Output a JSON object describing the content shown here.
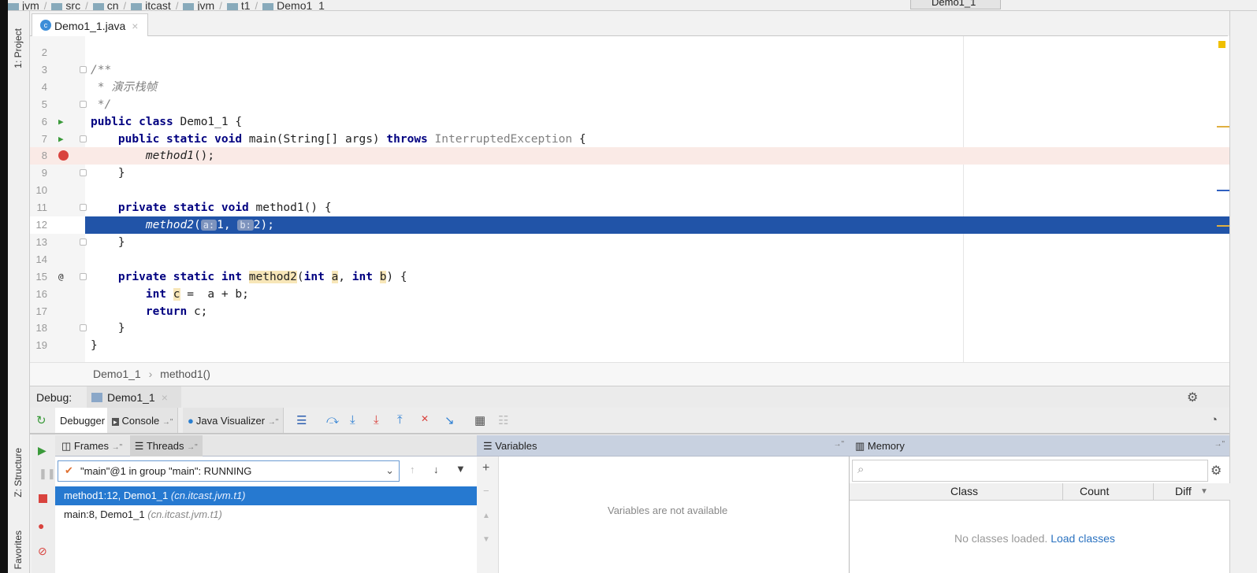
{
  "navbar": {
    "crumbs": [
      "jvm",
      "src",
      "cn",
      "itcast",
      "jvm",
      "t1",
      "Demo1_1"
    ],
    "run_config": "Demo1_1"
  },
  "left_tools": {
    "project": "1: Project",
    "structure": "Z: Structure",
    "favorites": "Favorites"
  },
  "editor_tab": {
    "label": "Demo1_1.java",
    "close": "×"
  },
  "code_lines": [
    {
      "n": "2",
      "tokens": []
    },
    {
      "n": "3",
      "tokens": [
        [
          "/**",
          "cm"
        ]
      ]
    },
    {
      "n": "4",
      "tokens": [
        [
          " * 演示栈帧",
          "cm"
        ]
      ]
    },
    {
      "n": "5",
      "tokens": [
        [
          " */",
          "cm"
        ]
      ]
    },
    {
      "n": "6",
      "tokens": [
        [
          "public class ",
          "kw"
        ],
        [
          "Demo1_1 {",
          ""
        ]
      ]
    },
    {
      "n": "7",
      "tokens": [
        [
          "    public static void ",
          "kw"
        ],
        [
          "main(String[] args) ",
          ""
        ],
        [
          "throws ",
          "kw"
        ],
        [
          "InterruptedException",
          "gr"
        ],
        [
          " {",
          ""
        ]
      ]
    },
    {
      "n": "8",
      "tokens": [
        [
          "        ",
          ""
        ],
        [
          "method1",
          "it"
        ],
        [
          "();",
          ""
        ]
      ]
    },
    {
      "n": "9",
      "tokens": [
        [
          "    }",
          ""
        ]
      ]
    },
    {
      "n": "10",
      "tokens": []
    },
    {
      "n": "11",
      "tokens": [
        [
          "    private static void ",
          "kw"
        ],
        [
          "method1() {",
          ""
        ]
      ]
    },
    {
      "n": "12",
      "tokens": [
        [
          "        ",
          ""
        ],
        [
          "method2",
          "it"
        ],
        [
          "(",
          ""
        ],
        [
          "a:",
          "hint"
        ],
        [
          "1, ",
          ""
        ],
        [
          "b:",
          "hint"
        ],
        [
          "2);",
          ""
        ]
      ]
    },
    {
      "n": "13",
      "tokens": [
        [
          "    }",
          ""
        ]
      ]
    },
    {
      "n": "14",
      "tokens": []
    },
    {
      "n": "15",
      "tokens": [
        [
          "    private static int ",
          "kw"
        ],
        [
          "method2",
          "hl"
        ],
        [
          "(",
          ""
        ],
        [
          "int ",
          "kw"
        ],
        [
          "a",
          "hl"
        ],
        [
          ", ",
          ""
        ],
        [
          "int ",
          "kw"
        ],
        [
          "b",
          "hl"
        ],
        [
          ") {",
          ""
        ]
      ]
    },
    {
      "n": "16",
      "tokens": [
        [
          "        int ",
          "kw"
        ],
        [
          "c",
          "hl"
        ],
        [
          " =  a + b;",
          ""
        ]
      ]
    },
    {
      "n": "17",
      "tokens": [
        [
          "        return ",
          "kw"
        ],
        [
          "c;",
          ""
        ]
      ]
    },
    {
      "n": "18",
      "tokens": [
        [
          "    }",
          ""
        ]
      ]
    },
    {
      "n": "19",
      "tokens": [
        [
          "}",
          ""
        ]
      ]
    }
  ],
  "breadcrumb": {
    "class": "Demo1_1",
    "sep": "›",
    "method": "method1()"
  },
  "debug": {
    "label": "Debug:",
    "session": "Demo1_1",
    "close": "×"
  },
  "toolbar": {
    "debugger": "Debugger",
    "console": "Console",
    "visualizer": "Java Visualizer",
    "pin": "→\""
  },
  "frames": {
    "title": "Frames",
    "threads": "Threads",
    "pin": "→\"",
    "thread_selected": "\"main\"@1 in group \"main\": RUNNING",
    "items": [
      {
        "loc": "method1:12, Demo1_1",
        "pkg": "(cn.itcast.jvm.t1)",
        "selected": true
      },
      {
        "loc": "main:8, Demo1_1",
        "pkg": "(cn.itcast.jvm.t1)",
        "selected": false
      }
    ]
  },
  "variables": {
    "title": "Variables",
    "empty": "Variables are not available",
    "pin": "→\""
  },
  "memory": {
    "title": "Memory",
    "pin": "→\"",
    "columns": [
      "Class",
      "Count",
      "Diff"
    ],
    "empty": "No classes loaded.",
    "load": "Load classes"
  },
  "colors": {
    "selection": "#2154a8",
    "breakpoint_line": "#faeae6",
    "panel_header": "#c8d1e0",
    "frame_selected": "#2679d0",
    "keyword": "#000080"
  }
}
